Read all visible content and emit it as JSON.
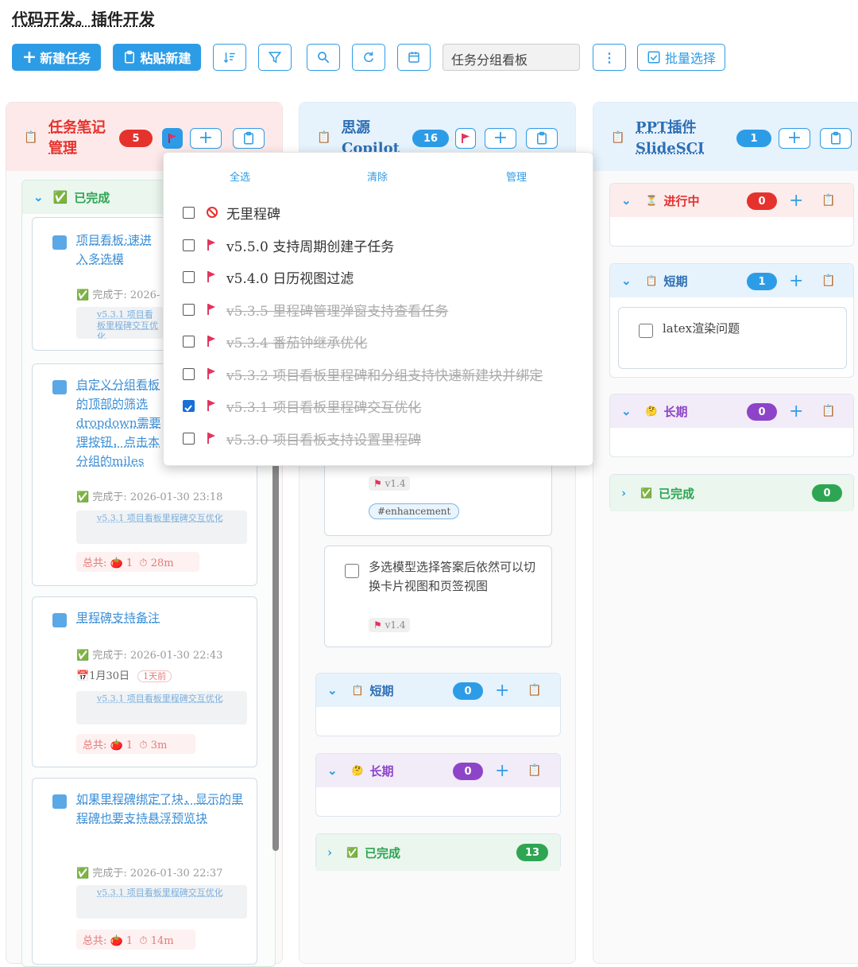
{
  "page_title": "代码开发。插件开发",
  "toolbar": {
    "new_task": "新建任务",
    "paste_new": "粘贴新建",
    "view_select": "任务分组看板",
    "batch_select": "批量选择"
  },
  "columns": [
    {
      "title": "任务笔记管理",
      "count": "5",
      "groups": [
        {
          "name": "已完成"
        }
      ],
      "cards": [
        {
          "title": "项目看板:速进入多选模",
          "completed": "完成于: 2026-",
          "milestone": "v5.3.1 项目看板里程碑交互优化"
        },
        {
          "title": "自定义分组看板的顶部的筛选dropdown需要理按钮，点击本分组的miles",
          "completed": "完成于: 2026-01-30 23:18",
          "milestone": "v5.3.1 项目看板里程碑交互优化",
          "total_label": "总共:",
          "tomato": "1",
          "time": "28m"
        },
        {
          "title": "里程碑支持备注",
          "completed": "完成于: 2026-01-30 22:43",
          "date": "1月30日",
          "ago": "1天前",
          "milestone": "v5.3.1 项目看板里程碑交互优化",
          "total_label": "总共:",
          "tomato": "1",
          "time": "3m"
        },
        {
          "title": "如果里程碑绑定了块，显示的里程碑也要支持悬浮预览块",
          "completed": "完成于: 2026-01-30 22:37",
          "milestone": "v5.3.1 项目看板里程碑交互优化",
          "total_label": "总共:",
          "tomato": "1",
          "time": "14m"
        }
      ]
    },
    {
      "title": "思源Copilot",
      "count": "16",
      "cards": [
        {
          "tag": "v1.4",
          "hashtag": "#enhancement"
        },
        {
          "title": "多选模型选择答案后依然可以切换卡片视图和页签视图",
          "tag": "v1.4"
        }
      ],
      "groups": [
        {
          "name": "短期",
          "count": "0"
        },
        {
          "name": "长期",
          "count": "0"
        },
        {
          "name": "已完成",
          "count": "13"
        }
      ]
    },
    {
      "title": "PPT插件SlideSCI",
      "count": "1",
      "groups": [
        {
          "name": "进行中",
          "count": "0"
        },
        {
          "name": "短期",
          "count": "1",
          "card": "latex渲染问题"
        },
        {
          "name": "长期",
          "count": "0"
        },
        {
          "name": "已完成",
          "count": "0"
        }
      ]
    }
  ],
  "dropdown": {
    "select_all": "全选",
    "clear": "清除",
    "manage": "管理",
    "items": [
      {
        "label": "无里程碑",
        "checked": false,
        "done": false,
        "icon": "no-entry-icon"
      },
      {
        "label": "v5.5.0 支持周期创建子任务",
        "checked": false,
        "done": false
      },
      {
        "label": "v5.4.0 日历视图过滤",
        "checked": false,
        "done": false
      },
      {
        "label": "v5.3.5 里程碑管理弹窗支持查看任务",
        "checked": false,
        "done": true
      },
      {
        "label": "v5.3.4 番茄钟继承优化",
        "checked": false,
        "done": true
      },
      {
        "label": "v5.3.2 项目看板里程碑和分组支持快速新建块并绑定",
        "checked": false,
        "done": true
      },
      {
        "label": "v5.3.1 项目看板里程碑交互优化",
        "checked": true,
        "done": true
      },
      {
        "label": "v5.3.0 项目看板支持设置里程碑",
        "checked": false,
        "done": true
      }
    ]
  },
  "colors": {
    "accent": "#2d9ce6",
    "red": "#e5322d",
    "green": "#2ea552",
    "purple": "#8e44c8"
  }
}
